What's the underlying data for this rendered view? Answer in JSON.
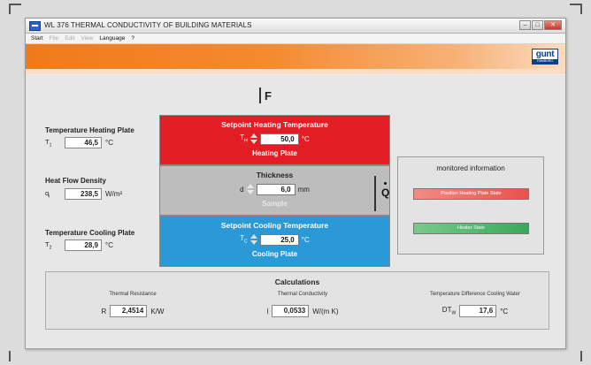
{
  "window": {
    "title": "WL 376 THERMAL CONDUCTIVITY OF BUILDING MATERIALS",
    "menu": [
      {
        "label": "Start",
        "enabled": true
      },
      {
        "label": "File",
        "enabled": false
      },
      {
        "label": "Edit",
        "enabled": false
      },
      {
        "label": "View",
        "enabled": false
      },
      {
        "label": "Language",
        "enabled": true
      },
      {
        "label": "?",
        "enabled": true
      }
    ]
  },
  "logo": {
    "main": "gunt",
    "sub": "HAMBURG"
  },
  "diagram": {
    "force_label": "F",
    "heat_flow_label": "Q"
  },
  "heating_plate": {
    "setpoint_title": "Setpoint Heating Temperature",
    "symbol": "T",
    "symbol_sub": "H",
    "value": "50,0",
    "unit": "°C",
    "name": "Heating Plate"
  },
  "sample": {
    "title": "Thickness",
    "symbol": "d",
    "value": "6,0",
    "unit": "mm",
    "name": "Sample"
  },
  "cooling_plate": {
    "setpoint_title": "Setpoint Cooling Temperature",
    "symbol": "T",
    "symbol_sub": "C",
    "value": "25,0",
    "unit": "°C",
    "name": "Cooling Plate"
  },
  "readouts": {
    "heating": {
      "label": "Temperature Heating Plate",
      "symbol": "T",
      "symbol_sub": "1",
      "value": "46,5",
      "unit": "°C"
    },
    "flow": {
      "label": "Heat Flow Density",
      "symbol": "q",
      "symbol_sub": "i",
      "value": "238,5",
      "unit": "W/m²"
    },
    "cooling": {
      "label": "Temperature Cooling Plate",
      "symbol": "T",
      "symbol_sub": "2",
      "value": "28,9",
      "unit": "°C"
    }
  },
  "monitor": {
    "title": "monitored information",
    "indicators": [
      {
        "label": "Position Heating Plate State",
        "color": "#e8534a"
      },
      {
        "label": "Heater State",
        "color": "#3aa859"
      }
    ]
  },
  "calculations": {
    "title": "Calculations",
    "items": [
      {
        "label": "Thermal Resistance",
        "symbol": "R",
        "value": "2,4514",
        "unit": "K/W"
      },
      {
        "label": "Thermal Conductivity",
        "symbol": "l",
        "value": "0,0533",
        "unit": "W/(m K)"
      },
      {
        "label": "Temperature Difference Cooling Water",
        "symbol": "DT",
        "symbol_sub": "W",
        "value": "17,6",
        "unit": "°C"
      }
    ]
  }
}
